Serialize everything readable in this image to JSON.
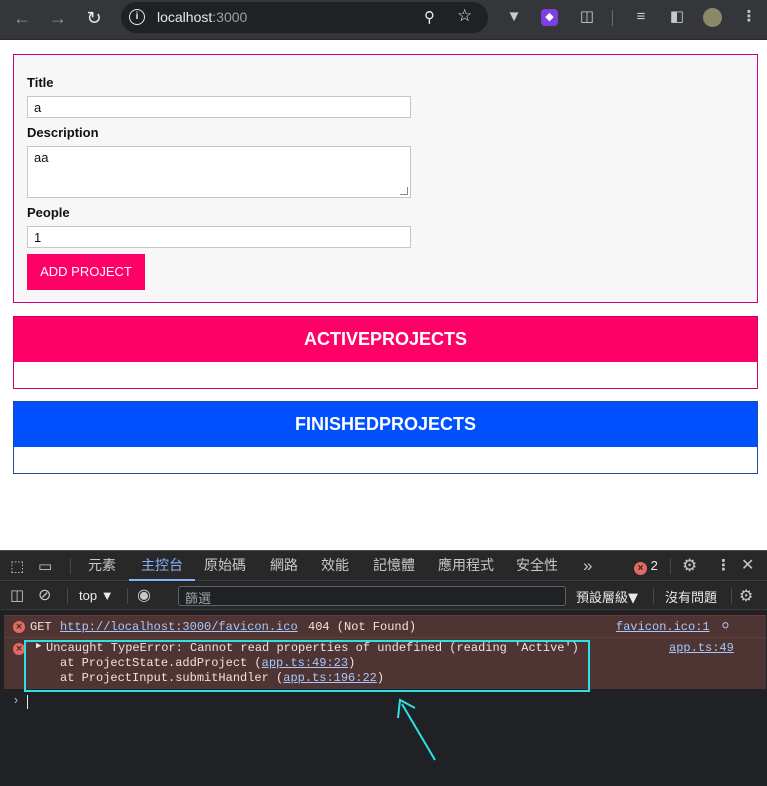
{
  "browser": {
    "url_host": "localhost",
    "url_port": ":3000"
  },
  "form": {
    "title_label": "Title",
    "title_value": "a",
    "description_label": "Description",
    "description_value": "aa",
    "people_label": "People",
    "people_value": "1",
    "submit_label": "ADD PROJECT"
  },
  "sections": {
    "active_title": "ACTIVEPROJECTS",
    "finished_title": "FINISHEDPROJECTS"
  },
  "devtools": {
    "tabs": [
      "元素",
      "主控台",
      "原始碼",
      "網路",
      "效能",
      "記憶體",
      "應用程式",
      "安全性"
    ],
    "selected_tab": "主控台",
    "error_count": "2",
    "context": "top",
    "filter_placeholder": "篩選",
    "levels_label": "預設層級",
    "issues_label": "沒有問題",
    "messages": {
      "get_method": "GET",
      "get_url": "http://localhost:3000/favicon.ico",
      "get_status": "404 (Not Found)",
      "get_source": "favicon.ico:1",
      "error_text": "Uncaught TypeError: Cannot read properties of undefined (reading 'Active')",
      "error_source": "app.ts:49",
      "stack_1_text": "at ProjectState.addProject (",
      "stack_1_link": "app.ts:49:23",
      "stack_2_text": "at ProjectInput.submitHandler (",
      "stack_2_link": "app.ts:196:22",
      "close_paren": ")"
    }
  },
  "colors": {
    "accent_pink": "#ff0066",
    "accent_blue": "#0050ff",
    "annotation": "#2de0e6"
  }
}
